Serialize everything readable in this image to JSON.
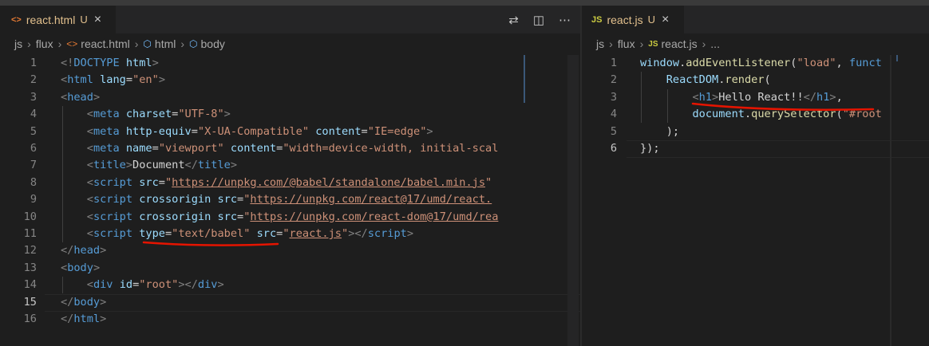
{
  "left": {
    "tab": {
      "icon": "<>",
      "name": "react.html",
      "status": "U",
      "close": "×"
    },
    "actions": [
      "⇄",
      "◫",
      "⋯"
    ],
    "breadcrumb": [
      "js",
      "flux",
      "react.html",
      "html",
      "body"
    ],
    "lines": [
      {
        "n": "1",
        "active": false,
        "tokens": [
          [
            "b",
            "<!"
          ],
          [
            "t",
            "DOCTYPE"
          ],
          [
            "x",
            " "
          ],
          [
            "a",
            "html"
          ],
          [
            "b",
            ">"
          ]
        ]
      },
      {
        "n": "2",
        "active": false,
        "tokens": [
          [
            "b",
            "<"
          ],
          [
            "t",
            "html"
          ],
          [
            "x",
            " "
          ],
          [
            "a",
            "lang"
          ],
          [
            "x",
            "="
          ],
          [
            "s",
            "\"en\""
          ],
          [
            "b",
            ">"
          ]
        ]
      },
      {
        "n": "3",
        "active": false,
        "tokens": [
          [
            "b",
            "<"
          ],
          [
            "t",
            "head"
          ],
          [
            "b",
            ">"
          ]
        ]
      },
      {
        "n": "4",
        "active": false,
        "tokens": [
          [
            "x",
            "    "
          ],
          [
            "b",
            "<"
          ],
          [
            "t",
            "meta"
          ],
          [
            "x",
            " "
          ],
          [
            "a",
            "charset"
          ],
          [
            "x",
            "="
          ],
          [
            "s",
            "\"UTF-8\""
          ],
          [
            "b",
            ">"
          ]
        ]
      },
      {
        "n": "5",
        "active": false,
        "tokens": [
          [
            "x",
            "    "
          ],
          [
            "b",
            "<"
          ],
          [
            "t",
            "meta"
          ],
          [
            "x",
            " "
          ],
          [
            "a",
            "http-equiv"
          ],
          [
            "x",
            "="
          ],
          [
            "s",
            "\"X-UA-Compatible\""
          ],
          [
            "x",
            " "
          ],
          [
            "a",
            "content"
          ],
          [
            "x",
            "="
          ],
          [
            "s",
            "\"IE=edge\""
          ],
          [
            "b",
            ">"
          ]
        ]
      },
      {
        "n": "6",
        "active": false,
        "tokens": [
          [
            "x",
            "    "
          ],
          [
            "b",
            "<"
          ],
          [
            "t",
            "meta"
          ],
          [
            "x",
            " "
          ],
          [
            "a",
            "name"
          ],
          [
            "x",
            "="
          ],
          [
            "s",
            "\"viewport\""
          ],
          [
            "x",
            " "
          ],
          [
            "a",
            "content"
          ],
          [
            "x",
            "="
          ],
          [
            "s",
            "\"width=device-width, initial-scal"
          ]
        ]
      },
      {
        "n": "7",
        "active": false,
        "tokens": [
          [
            "x",
            "    "
          ],
          [
            "b",
            "<"
          ],
          [
            "t",
            "title"
          ],
          [
            "b",
            ">"
          ],
          [
            "x",
            "Document"
          ],
          [
            "b",
            "</"
          ],
          [
            "t",
            "title"
          ],
          [
            "b",
            ">"
          ]
        ]
      },
      {
        "n": "8",
        "active": false,
        "tokens": [
          [
            "x",
            "    "
          ],
          [
            "b",
            "<"
          ],
          [
            "t",
            "script"
          ],
          [
            "x",
            " "
          ],
          [
            "a",
            "src"
          ],
          [
            "x",
            "="
          ],
          [
            "s",
            "\""
          ],
          [
            "su",
            "https://unpkg.com/@babel/standalone/babel.min.js"
          ],
          [
            "s",
            "\""
          ]
        ]
      },
      {
        "n": "9",
        "active": false,
        "tokens": [
          [
            "x",
            "    "
          ],
          [
            "b",
            "<"
          ],
          [
            "t",
            "script"
          ],
          [
            "x",
            " "
          ],
          [
            "a",
            "crossorigin"
          ],
          [
            "x",
            " "
          ],
          [
            "a",
            "src"
          ],
          [
            "x",
            "="
          ],
          [
            "s",
            "\""
          ],
          [
            "su",
            "https://unpkg.com/react@17/umd/react."
          ]
        ]
      },
      {
        "n": "10",
        "active": false,
        "tokens": [
          [
            "x",
            "    "
          ],
          [
            "b",
            "<"
          ],
          [
            "t",
            "script"
          ],
          [
            "x",
            " "
          ],
          [
            "a",
            "crossorigin"
          ],
          [
            "x",
            " "
          ],
          [
            "a",
            "src"
          ],
          [
            "x",
            "="
          ],
          [
            "s",
            "\""
          ],
          [
            "su",
            "https://unpkg.com/react-dom@17/umd/rea"
          ]
        ]
      },
      {
        "n": "11",
        "active": false,
        "tokens": [
          [
            "x",
            "    "
          ],
          [
            "b",
            "<"
          ],
          [
            "t",
            "script"
          ],
          [
            "x",
            " "
          ],
          [
            "a",
            "type"
          ],
          [
            "x",
            "="
          ],
          [
            "s",
            "\"text/babel\""
          ],
          [
            "x",
            " "
          ],
          [
            "a",
            "src"
          ],
          [
            "x",
            "="
          ],
          [
            "s",
            "\""
          ],
          [
            "su",
            "react.js"
          ],
          [
            "s",
            "\""
          ],
          [
            "b",
            ">"
          ],
          [
            "b",
            "</"
          ],
          [
            "t",
            "script"
          ],
          [
            "b",
            ">"
          ]
        ]
      },
      {
        "n": "12",
        "active": false,
        "tokens": [
          [
            "b",
            "</"
          ],
          [
            "t",
            "head"
          ],
          [
            "b",
            ">"
          ]
        ]
      },
      {
        "n": "13",
        "active": false,
        "tokens": [
          [
            "b",
            "<"
          ],
          [
            "t",
            "body"
          ],
          [
            "b",
            ">"
          ]
        ]
      },
      {
        "n": "14",
        "active": false,
        "tokens": [
          [
            "x",
            "    "
          ],
          [
            "b",
            "<"
          ],
          [
            "t",
            "div"
          ],
          [
            "x",
            " "
          ],
          [
            "a",
            "id"
          ],
          [
            "x",
            "="
          ],
          [
            "s",
            "\"root\""
          ],
          [
            "b",
            ">"
          ],
          [
            "b",
            "</"
          ],
          [
            "t",
            "div"
          ],
          [
            "b",
            ">"
          ]
        ]
      },
      {
        "n": "15",
        "active": true,
        "tokens": [
          [
            "b",
            "</"
          ],
          [
            "t",
            "body"
          ],
          [
            "b",
            ">"
          ]
        ]
      },
      {
        "n": "16",
        "active": false,
        "tokens": [
          [
            "b",
            "</"
          ],
          [
            "t",
            "html"
          ],
          [
            "b",
            ">"
          ]
        ]
      }
    ]
  },
  "right": {
    "tab": {
      "icon": "JS",
      "name": "react.js",
      "status": "U",
      "close": "×"
    },
    "breadcrumb": [
      "js",
      "flux",
      "react.js",
      "..."
    ],
    "lines": [
      {
        "n": "1",
        "active": false,
        "tokens": [
          [
            "a",
            "window"
          ],
          [
            "x",
            "."
          ],
          [
            "f",
            "addEventListener"
          ],
          [
            "x",
            "("
          ],
          [
            "s",
            "\"load\""
          ],
          [
            "x",
            ", "
          ],
          [
            "t",
            "funct"
          ]
        ]
      },
      {
        "n": "2",
        "active": false,
        "tokens": [
          [
            "x",
            "    "
          ],
          [
            "a",
            "ReactDOM"
          ],
          [
            "x",
            "."
          ],
          [
            "f",
            "render"
          ],
          [
            "x",
            "("
          ]
        ]
      },
      {
        "n": "3",
        "active": false,
        "tokens": [
          [
            "x",
            "        "
          ],
          [
            "b",
            "<"
          ],
          [
            "t",
            "h1"
          ],
          [
            "b",
            ">"
          ],
          [
            "x",
            "Hello React!!"
          ],
          [
            "b",
            "</"
          ],
          [
            "t",
            "h1"
          ],
          [
            "b",
            ">"
          ],
          [
            "x",
            ","
          ]
        ]
      },
      {
        "n": "4",
        "active": false,
        "tokens": [
          [
            "x",
            "        "
          ],
          [
            "a",
            "document"
          ],
          [
            "x",
            "."
          ],
          [
            "f",
            "querySelector"
          ],
          [
            "x",
            "("
          ],
          [
            "s",
            "\"#root"
          ]
        ]
      },
      {
        "n": "5",
        "active": false,
        "tokens": [
          [
            "x",
            "    "
          ],
          [
            "x",
            ");"
          ]
        ]
      },
      {
        "n": "6",
        "active": true,
        "tokens": [
          [
            "x",
            "});"
          ]
        ]
      }
    ]
  },
  "colors": {
    "accent": "#e2c08d",
    "js_icon": "#cbcb41",
    "html_icon": "#e37933",
    "annotation": "#e51400"
  }
}
